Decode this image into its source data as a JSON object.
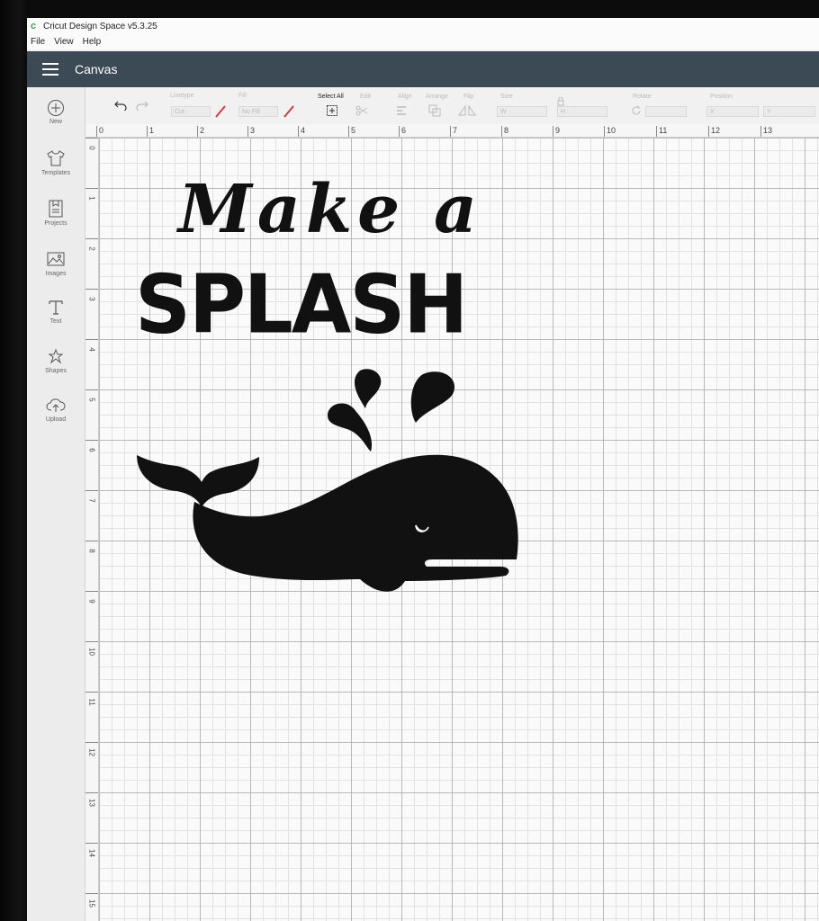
{
  "window": {
    "title": "Cricut Design Space  v5.3.25"
  },
  "menu": [
    "File",
    "View",
    "Help"
  ],
  "header": {
    "title": "Canvas"
  },
  "sidebar": {
    "items": [
      {
        "label": "New",
        "icon": "plus-circle-icon"
      },
      {
        "label": "Templates",
        "icon": "shirt-icon"
      },
      {
        "label": "Projects",
        "icon": "projects-icon"
      },
      {
        "label": "Images",
        "icon": "image-icon"
      },
      {
        "label": "Text",
        "icon": "text-icon"
      },
      {
        "label": "Shapes",
        "icon": "shapes-icon"
      },
      {
        "label": "Upload",
        "icon": "upload-icon"
      }
    ]
  },
  "toolbar": {
    "linetype_label": "Linetype",
    "linetype_value": "Cut",
    "fill_label": "Fill",
    "fill_value": "No Fill",
    "select_all_label": "Select All",
    "edit_label": "Edit",
    "align_label": "Align",
    "arrange_label": "Arrange",
    "flip_label": "Flip",
    "size_label": "Size",
    "size_w": "W",
    "size_h": "H",
    "rotate_label": "Rotate",
    "position_label": "Position",
    "position_x": "X",
    "position_y": "Y"
  },
  "ruler": {
    "horizontal": [
      "0",
      "1",
      "2",
      "3",
      "4",
      "5",
      "6",
      "7",
      "8",
      "9",
      "10",
      "11",
      "12",
      "13"
    ],
    "vertical": [
      "0",
      "1",
      "2",
      "3",
      "4",
      "5",
      "6",
      "7",
      "8",
      "9",
      "10",
      "11",
      "12",
      "13",
      "14",
      "15"
    ]
  },
  "design": {
    "line1": "Make  a",
    "line2": "SPLASH",
    "graphic": "whale-icon"
  },
  "colors": {
    "header": "#3c4a56",
    "design": "#111111",
    "accent_red": "#d23b3b"
  }
}
